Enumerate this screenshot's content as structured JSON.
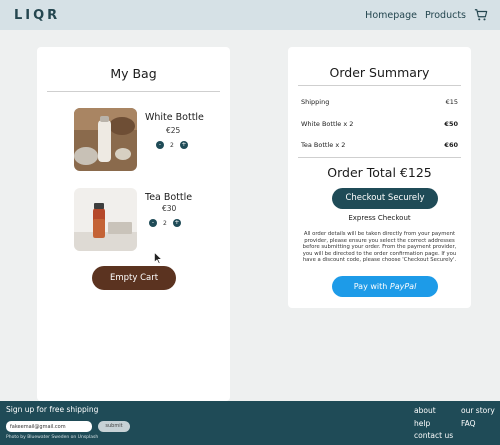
{
  "header": {
    "logo": "LIQR",
    "nav": {
      "homepage": "Homepage",
      "products": "Products"
    },
    "cart_icon": "cart-icon"
  },
  "bag": {
    "title": "My Bag",
    "items": [
      {
        "name": "White Bottle",
        "price": "€25",
        "qty": "2",
        "minus": "-",
        "plus": "+"
      },
      {
        "name": "Tea Bottle",
        "price": "€30",
        "qty": "2",
        "minus": "-",
        "plus": "+"
      }
    ],
    "empty_label": "Empty Cart"
  },
  "summary": {
    "title": "Order Summary",
    "rows": [
      {
        "label": "Shipping",
        "value": "€15"
      },
      {
        "label": "White Bottle x 2",
        "value": "€50"
      },
      {
        "label": "Tea Bottle x 2",
        "value": "€60"
      }
    ],
    "total": "Order Total €125",
    "checkout_label": "Checkout Securely",
    "express_label": "Express Checkout",
    "notice": "All order details will be taken directly from your payment provider, please ensure you select the correct addresses before submitting your order. From the payment provider, you will be directed to the order confirmation page. If you have a discount code, please choose 'Checkout Securely'.",
    "paypal_prefix": "Pay with",
    "paypal_brand": "PayPal"
  },
  "footer": {
    "signup": "Sign up for free shipping",
    "email_value": "fakeemail@gmail.com",
    "submit_label": "submit",
    "credit": "Photo by Bluewater Sweden on Unsplash",
    "links": {
      "about": "about",
      "help": "help",
      "contact": "contact us",
      "story": "our story",
      "faq": "FAQ"
    }
  },
  "colors": {
    "header_bg": "#d6e1e6",
    "teal": "#1f4b57",
    "brown": "#5b3320",
    "paypal_blue": "#1d9be8"
  }
}
